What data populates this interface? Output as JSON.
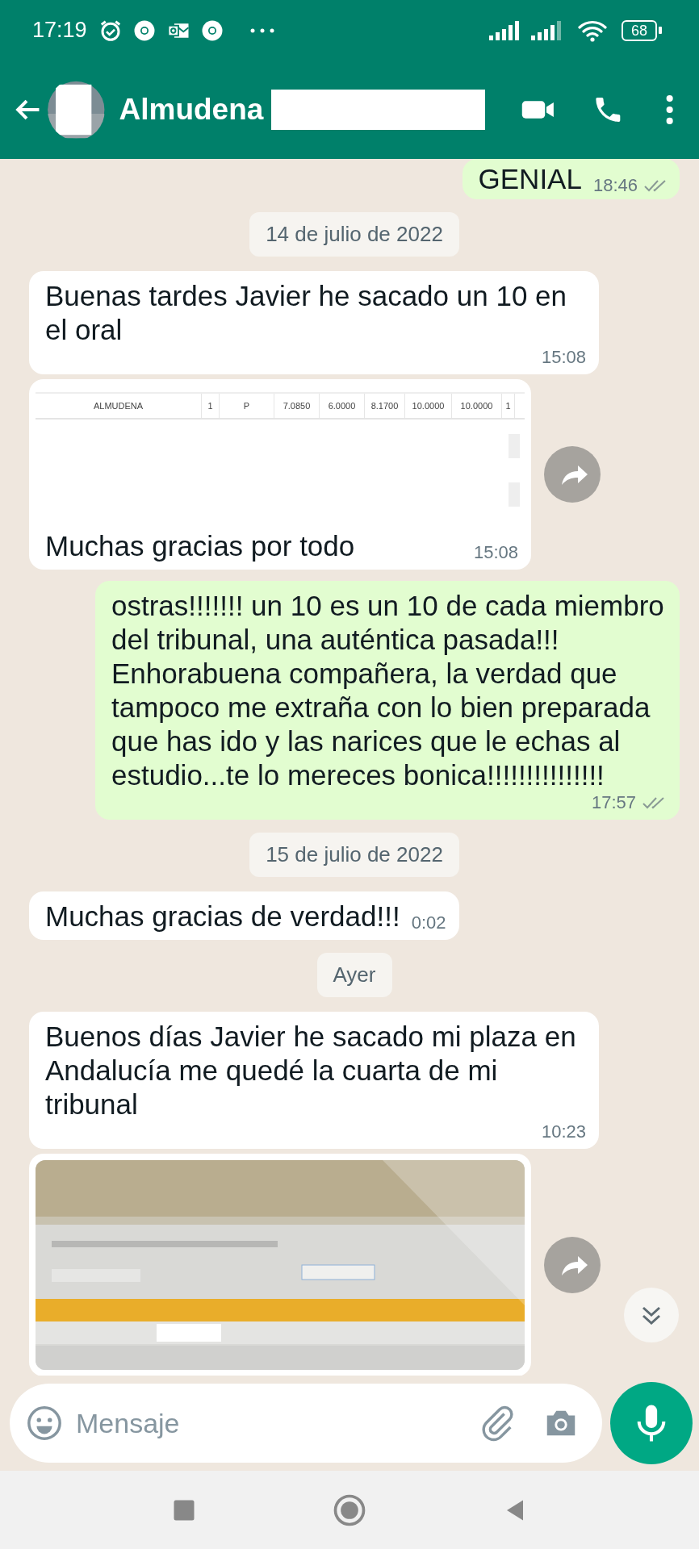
{
  "status_bar": {
    "time": "17:19",
    "battery": "68"
  },
  "header": {
    "contact_name": "Almudena"
  },
  "messages": [
    {
      "kind": "sent",
      "text": "GENIAL",
      "time": "18:46",
      "read": false
    },
    {
      "kind": "date",
      "text": "14 de julio de 2022"
    },
    {
      "kind": "received",
      "text": "Buenas tardes Javier he sacado un 10 en el oral",
      "time": "15:08"
    },
    {
      "kind": "received",
      "attachment": {
        "kind": "table",
        "cells": [
          "ALMUDENA",
          "1",
          "P",
          "7.0850",
          "6.0000",
          "8.1700",
          "10.0000",
          "10.0000",
          "1"
        ]
      },
      "text": "Muchas gracias por todo",
      "time": "15:08"
    },
    {
      "kind": "sent",
      "text": "ostras!!!!!!! un 10 es un 10 de cada miembro del tribunal, una auténtica pasada!!! Enhorabuena compañera, la verdad que tampoco me extraña con lo bien preparada que has ido y las narices que le echas al estudio...te lo mereces bonica!!!!!!!!!!!!!!!",
      "time": "17:57",
      "read": false
    },
    {
      "kind": "date",
      "text": "15 de julio de 2022"
    },
    {
      "kind": "received",
      "text": "Muchas gracias de verdad!!!",
      "time": "0:02"
    },
    {
      "kind": "date",
      "text": "Ayer"
    },
    {
      "kind": "received",
      "text": "Buenos días Javier he sacado mi plaza en Andalucía me quedé la cuarta de mi tribunal",
      "time": "10:23"
    },
    {
      "kind": "received"
    }
  ],
  "input": {
    "placeholder": "Mensaje"
  }
}
